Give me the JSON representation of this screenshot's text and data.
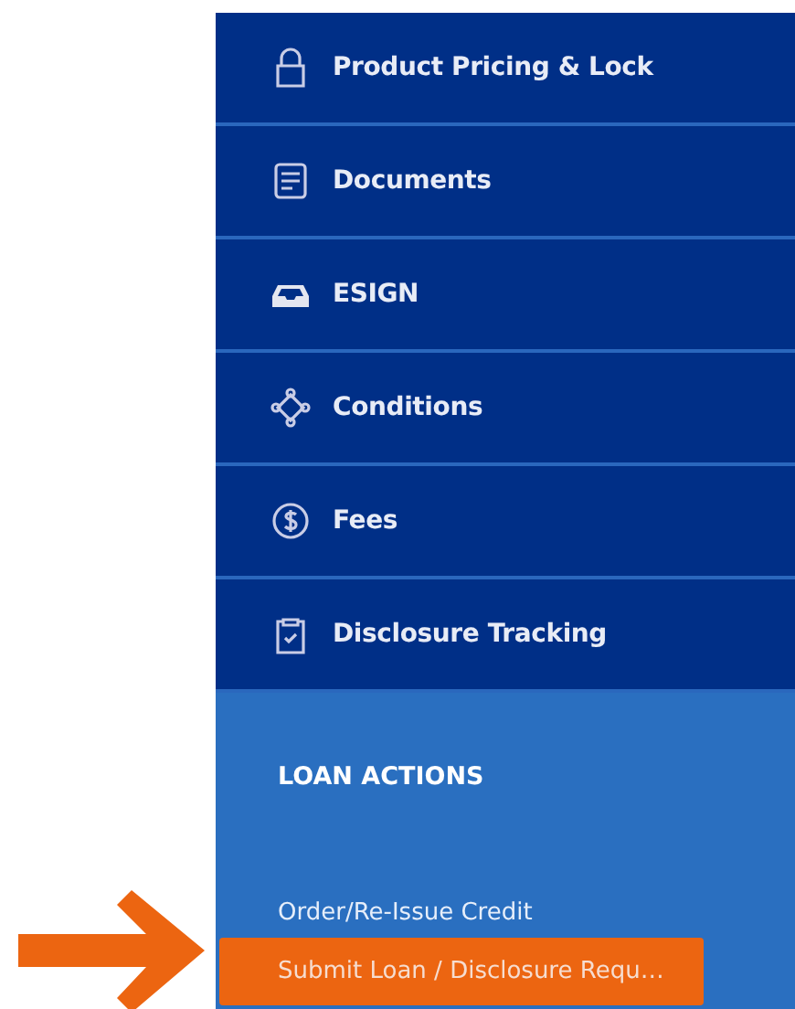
{
  "nav_items": [
    {
      "label": "Product Pricing & Lock"
    },
    {
      "label": "Documents"
    },
    {
      "label": "ESIGN"
    },
    {
      "label": "Conditions"
    },
    {
      "label": "Fees"
    },
    {
      "label": "Disclosure Tracking"
    }
  ],
  "loan_actions": {
    "heading": "LOAN ACTIONS",
    "items": [
      {
        "label": "Order/Re-Issue Credit",
        "selected": false
      },
      {
        "label": "Submit Loan / Disclosure Requ…",
        "selected": true
      }
    ]
  }
}
